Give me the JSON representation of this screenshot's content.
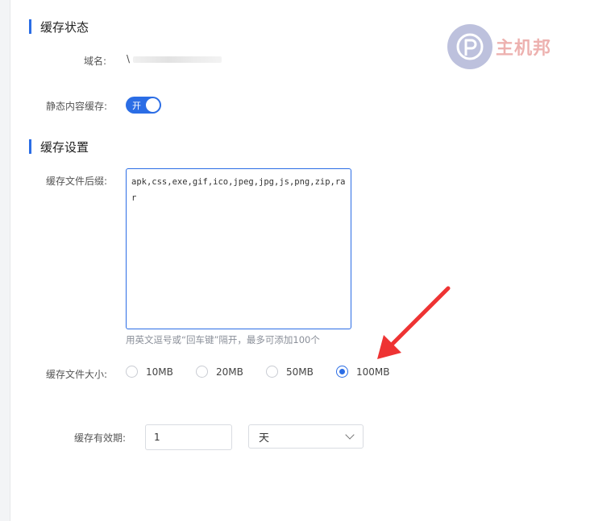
{
  "cache_status": {
    "title": "缓存状态",
    "domain_label": "域名:",
    "domain_value": "\\",
    "static_cache_label": "静态内容缓存:",
    "static_cache_toggle": "开"
  },
  "cache_settings": {
    "title": "缓存设置",
    "suffix_label": "缓存文件后缀:",
    "suffix_value": "apk,css,exe,gif,ico,jpeg,jpg,js,png,zip,rar",
    "suffix_hint": "用英文逗号或“回车键”隔开，最多可添加100个",
    "size_label": "缓存文件大小:",
    "size_options": [
      "10MB",
      "20MB",
      "50MB",
      "100MB"
    ],
    "size_selected": "100MB",
    "expiry_label": "缓存有效期:",
    "expiry_value": "1",
    "expiry_unit": "天"
  },
  "watermark": {
    "text": "主机邦"
  },
  "colors": {
    "accent": "#2b6de5",
    "annotation_arrow": "#ee3333"
  }
}
